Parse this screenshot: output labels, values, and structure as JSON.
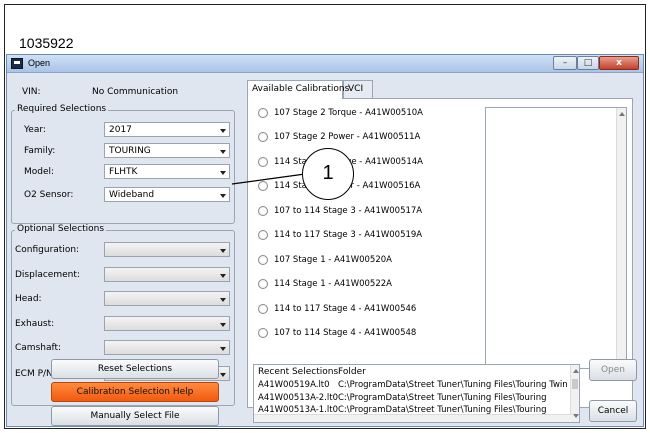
{
  "figure_id": "1035922",
  "window": {
    "title": "Open",
    "controls": {
      "minimize": "–",
      "maximize": "□",
      "close": "x"
    }
  },
  "vin": {
    "label": "VIN:",
    "value": "No Communication"
  },
  "required": {
    "title": "Required Selections",
    "fields": [
      {
        "label": "Year:",
        "value": "2017"
      },
      {
        "label": "Family:",
        "value": "TOURING"
      },
      {
        "label": "Model:",
        "value": "FLHTK"
      },
      {
        "label": "O2 Sensor:",
        "value": "Wideband"
      }
    ]
  },
  "optional": {
    "title": "Optional Selections",
    "fields": [
      {
        "label": "Configuration:",
        "value": ""
      },
      {
        "label": "Displacement:",
        "value": ""
      },
      {
        "label": "Head:",
        "value": ""
      },
      {
        "label": "Exhaust:",
        "value": ""
      },
      {
        "label": "Camshaft:",
        "value": ""
      },
      {
        "label": "ECM P/N:",
        "value": ""
      }
    ]
  },
  "buttons": {
    "reset": "Reset Selections",
    "help": "Calibration Selection Help",
    "manual": "Manually Select File",
    "open": "Open",
    "cancel": "Cancel"
  },
  "tabs": [
    "Available Calibrations",
    "VCI"
  ],
  "calibrations": [
    "107 Stage 2 Torque - A41W00510A",
    "107 Stage 2 Power - A41W00511A",
    "114 Stage 2 Torque - A41W00514A",
    "114 Stage 2 Power - A41W00516A",
    "107 to 114 Stage 3 - A41W00517A",
    "114 to 117 Stage 3 - A41W00519A",
    "107 Stage 1 - A41W00520A",
    "114 Stage 1 - A41W00522A",
    "114 to 117 Stage 4 - A41W00546",
    "107 to 114 Stage 4 - A41W00548"
  ],
  "recent": {
    "headers": [
      "Recent Selections",
      "Folder"
    ],
    "rows": [
      {
        "file": "A41W00519A.lt0",
        "folder": "C:\\ProgramData\\Street Tuner\\Tuning Files\\Touring Twin"
      },
      {
        "file": "A41W00513A-2.lt0",
        "folder": "C:\\ProgramData\\Street Tuner\\Tuning Files\\Touring"
      },
      {
        "file": "A41W00513A-1.lt0",
        "folder": "C:\\ProgramData\\Street Tuner\\Tuning Files\\Touring"
      }
    ]
  },
  "callout": "1",
  "colors": {
    "help_button": "#f26a1b",
    "window_frame": "#a9c4e6"
  }
}
